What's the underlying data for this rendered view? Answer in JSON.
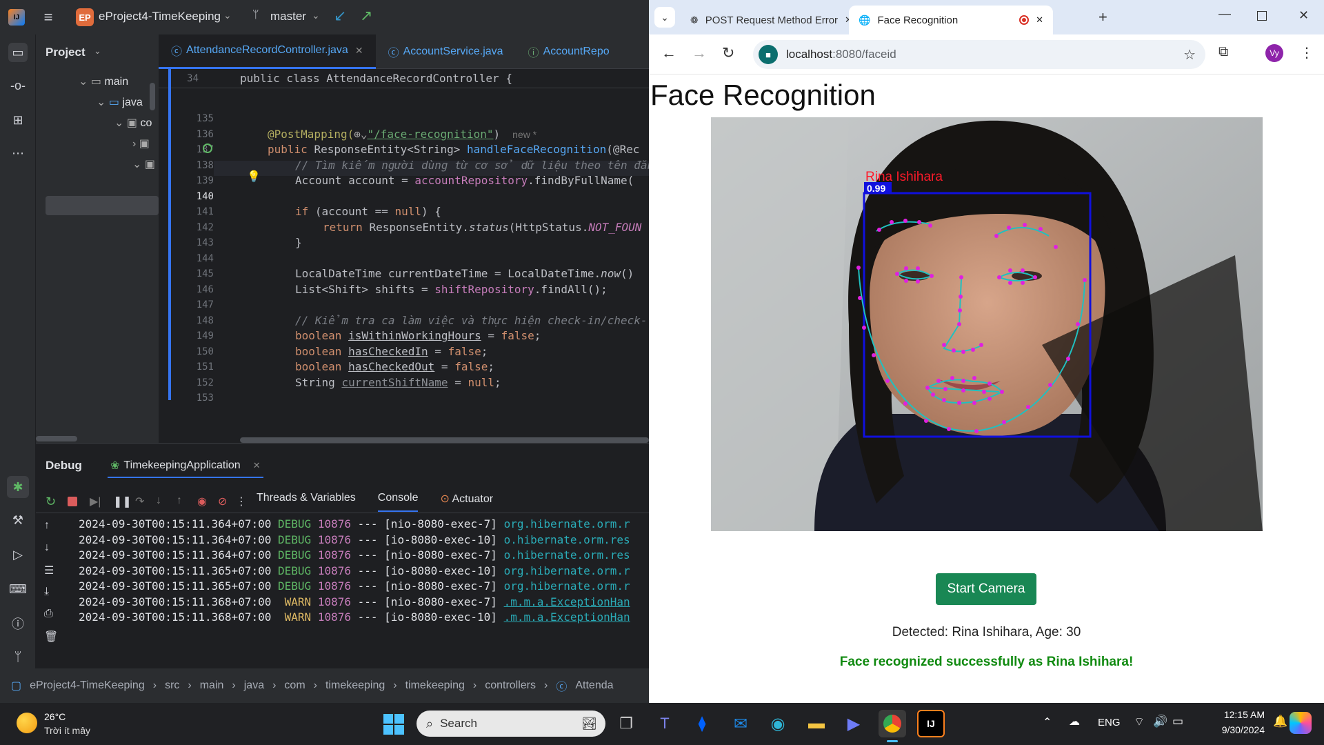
{
  "ide": {
    "project_name": "eProject4-TimeKeeping",
    "project_badge": "EP",
    "branch": "master",
    "project_panel_title": "Project",
    "tree": [
      {
        "label": "main"
      },
      {
        "label": "java"
      },
      {
        "label": "co"
      }
    ],
    "tabs": [
      {
        "label": "AttendanceRecordController.java",
        "active": true
      },
      {
        "label": "AccountService.java",
        "active": false
      },
      {
        "label": "AccountRepo",
        "active": false
      }
    ],
    "sticky_line": {
      "num": "34",
      "code": "public class AttendanceRecordController {"
    },
    "lines": [
      {
        "num": "135"
      },
      {
        "num": "136"
      },
      {
        "num": "137"
      },
      {
        "num": "138"
      },
      {
        "num": "139"
      },
      {
        "num": "140"
      },
      {
        "num": "141"
      },
      {
        "num": "142"
      },
      {
        "num": "143"
      },
      {
        "num": "144"
      },
      {
        "num": "145"
      },
      {
        "num": "146"
      },
      {
        "num": "147"
      },
      {
        "num": "148"
      },
      {
        "num": "149"
      },
      {
        "num": "150"
      },
      {
        "num": "151"
      },
      {
        "num": "152"
      },
      {
        "num": "153"
      }
    ],
    "code": {
      "l136_ann": "@PostMapping(",
      "l136_str": "\"/face-recognition\"",
      "l136_end": ")",
      "l136_hint": "new *",
      "l137_a": "public ",
      "l137_b": "ResponseEntity<String> ",
      "l137_c": "handleFaceRecognition",
      "l137_d": "(@Rec",
      "l138": "// Tìm kiếm người dùng từ cơ sở dữ liệu theo tên đăn",
      "l139_a": "Account account = ",
      "l139_b": "accountRepository",
      "l139_c": ".findByFullName(",
      "l141_a": "if ",
      "l141_b": "(account == ",
      "l141_c": "null",
      "l141_d": ") {",
      "l142_a": "return ",
      "l142_b": "ResponseEntity.",
      "l142_c": "status",
      "l142_d": "(HttpStatus.",
      "l142_e": "NOT_FOUN",
      "l143": "}",
      "l145_a": "LocalDateTime currentDateTime = LocalDateTime.",
      "l145_b": "now",
      "l145_c": "()",
      "l146_a": "List<Shift> shifts = ",
      "l146_b": "shiftRepository",
      "l146_c": ".findAll();",
      "l148": "// Kiểm tra ca làm việc và thực hiện check-in/check-",
      "l149_a": "boolean ",
      "l149_b": "isWithinWorkingHours",
      "l149_c": " = ",
      "l149_d": "false",
      "l149_e": ";",
      "l150_a": "boolean ",
      "l150_b": "hasCheckedIn",
      "l150_c": " = ",
      "l150_d": "false",
      "l150_e": ";",
      "l151_a": "boolean ",
      "l151_b": "hasCheckedOut",
      "l151_c": " = ",
      "l151_d": "false",
      "l151_e": ";",
      "l152_a": "String ",
      "l152_b": "currentShiftName",
      "l152_c": " = ",
      "l152_d": "null",
      "l152_e": ";"
    },
    "debug": {
      "title": "Debug",
      "session": "TimekeepingApplication",
      "subtabs": [
        "Threads & Variables",
        "Console",
        "Actuator"
      ],
      "active_subtab": "Console",
      "logs": [
        {
          "ts": "2024-09-30T00:15:11.364+07:00",
          "lvl": "DEBUG",
          "pid": "10876",
          "sep": "---",
          "thread": "[nio-8080-exec-7]",
          "logger": "org.hibernate.orm.r"
        },
        {
          "ts": "2024-09-30T00:15:11.364+07:00",
          "lvl": "DEBUG",
          "pid": "10876",
          "sep": "---",
          "thread": "[io-8080-exec-10]",
          "logger": "o.hibernate.orm.res"
        },
        {
          "ts": "2024-09-30T00:15:11.364+07:00",
          "lvl": "DEBUG",
          "pid": "10876",
          "sep": "---",
          "thread": "[nio-8080-exec-7]",
          "logger": "o.hibernate.orm.res"
        },
        {
          "ts": "2024-09-30T00:15:11.365+07:00",
          "lvl": "DEBUG",
          "pid": "10876",
          "sep": "---",
          "thread": "[io-8080-exec-10]",
          "logger": "org.hibernate.orm.r"
        },
        {
          "ts": "2024-09-30T00:15:11.365+07:00",
          "lvl": "DEBUG",
          "pid": "10876",
          "sep": "---",
          "thread": "[nio-8080-exec-7]",
          "logger": "org.hibernate.orm.r"
        },
        {
          "ts": "2024-09-30T00:15:11.368+07:00",
          "lvl": " WARN",
          "pid": "10876",
          "sep": "---",
          "thread": "[nio-8080-exec-7]",
          "logger": ".m.m.a.ExceptionHan"
        },
        {
          "ts": "2024-09-30T00:15:11.368+07:00",
          "lvl": " WARN",
          "pid": "10876",
          "sep": "---",
          "thread": "[io-8080-exec-10]",
          "logger": ".m.m.a.ExceptionHan"
        }
      ]
    },
    "breadcrumbs": [
      "eProject4-TimeKeeping",
      "src",
      "main",
      "java",
      "com",
      "timekeeping",
      "timekeeping",
      "controllers",
      "Attenda"
    ]
  },
  "browser": {
    "tabs": [
      {
        "label": "POST Request Method Error",
        "active": false
      },
      {
        "label": "Face Recognition",
        "active": true
      }
    ],
    "url_host": "localhost",
    "url_rest": ":8080/faceid",
    "profile_initial": "Vy",
    "page": {
      "heading": "Face Recognition",
      "face_label": "Rina Ishihara",
      "face_score": "0.99",
      "start_button": "Start Camera",
      "detected_text": "Detected: Rina Ishihara, Age: 30",
      "success_text": "Face recognized successfully as Rina Ishihara!"
    }
  },
  "taskbar": {
    "weather_temp": "26°C",
    "weather_desc": "Trời ít mây",
    "search_placeholder": "Search",
    "lang": "ENG",
    "time": "12:15 AM",
    "date": "9/30/2024"
  },
  "colors": {
    "ide_bg": "#1e1f22",
    "accent_blue": "#56a8f5",
    "button_green": "#198754",
    "success_green": "#108a10",
    "box_blue": "#1010dd",
    "landmark": "#e020e0",
    "contour": "#20c0c0"
  }
}
